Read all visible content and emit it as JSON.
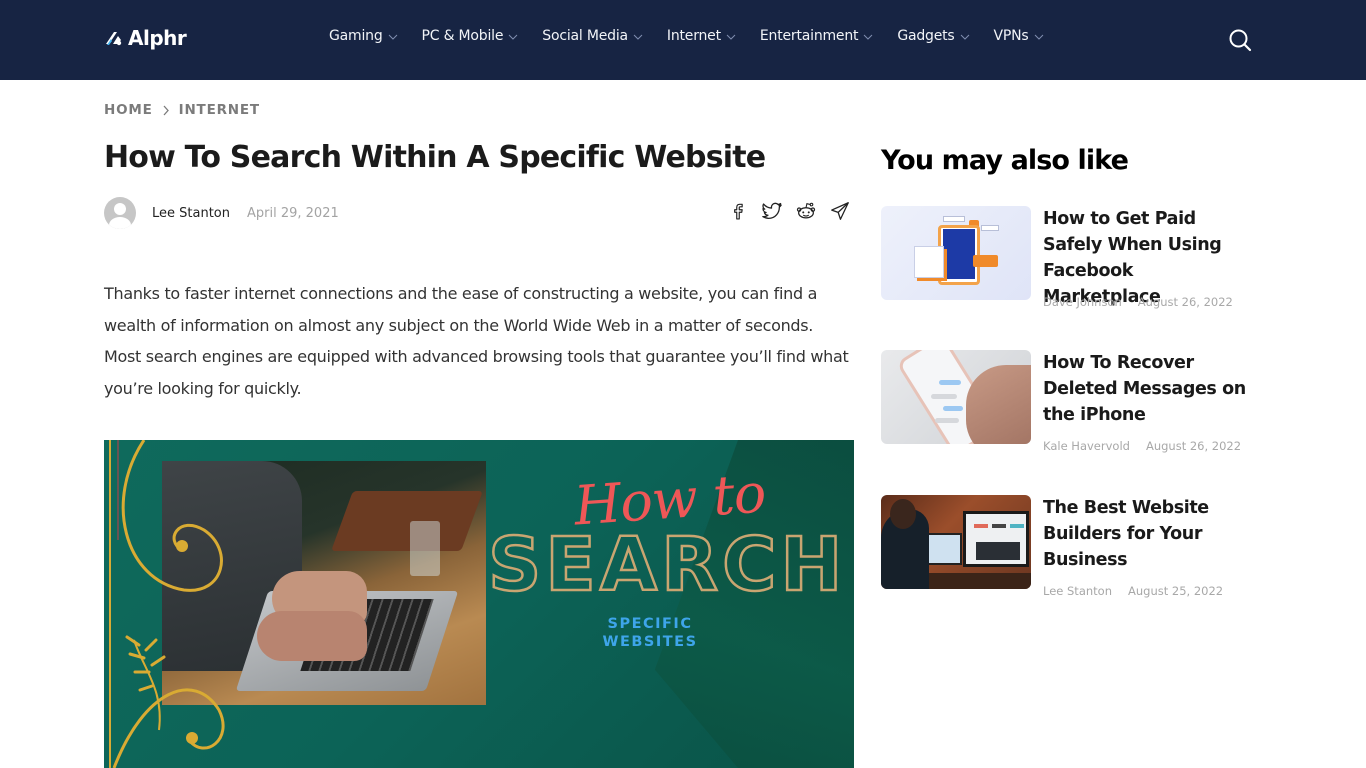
{
  "header": {
    "logo_text": "Alphr",
    "nav": [
      {
        "label": "Gaming"
      },
      {
        "label": "PC & Mobile"
      },
      {
        "label": "Social Media"
      },
      {
        "label": "Internet"
      },
      {
        "label": "Entertainment"
      },
      {
        "label": "Gadgets"
      },
      {
        "label": "VPNs"
      }
    ],
    "search_icon": "search-icon"
  },
  "breadcrumb": {
    "items": [
      "HOME",
      "INTERNET"
    ],
    "separator_icon": "chevron-right-icon"
  },
  "article": {
    "title": "How To Search Within A Specific Website",
    "author": "Lee Stanton",
    "date": "April 29, 2021",
    "share_icons": [
      "facebook-icon",
      "twitter-icon",
      "reddit-icon",
      "telegram-icon"
    ],
    "body": "Thanks to faster internet connections and the ease of constructing a website, you can find a wealth of information on almost any subject on the World Wide Web in a matter of seconds. Most search engines are equipped with advanced browsing tools that guarantee you’ll find what you’re looking for quickly.",
    "hero": {
      "line1": "How to",
      "line2": "SEARCH",
      "line3a": "SPECIFIC",
      "line3b": "WEBSITES"
    }
  },
  "sidebar": {
    "title": "You may also like",
    "accent_color": "#4f85cd",
    "items": [
      {
        "title": "How to Get Paid Safely When Using Facebook Marketplace",
        "author": "Dave Johnson",
        "date": "August 26, 2022"
      },
      {
        "title": "How To Recover Deleted Messages on the iPhone",
        "author": "Kale Havervold",
        "date": "August 26, 2022"
      },
      {
        "title": "The Best Website Builders for Your Business",
        "author": "Lee Stanton",
        "date": "August 25, 2022"
      }
    ]
  },
  "colors": {
    "header_bg": "#172443",
    "hero_bg": "#0c6357",
    "hero_accent_red": "#ef5757",
    "hero_accent_gold": "#c9a571",
    "hero_accent_blue": "#3ea5ea"
  }
}
